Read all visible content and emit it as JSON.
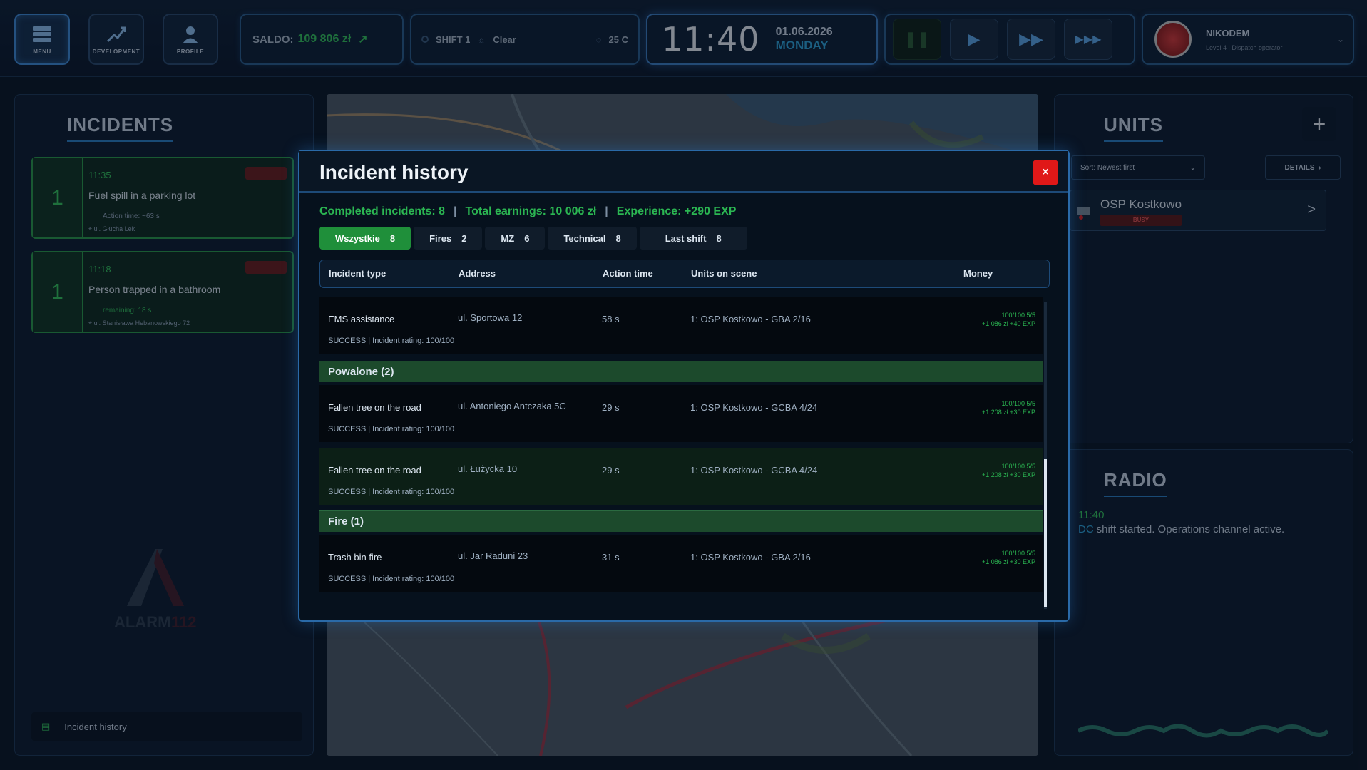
{
  "topbar": {
    "nav": [
      {
        "label": "MENU",
        "icon": "menu-icon"
      },
      {
        "label": "DEVELOPMENT",
        "icon": "development-icon"
      },
      {
        "label": "PROFILE",
        "icon": "profile-icon"
      }
    ],
    "saldo_label": "SALDO:",
    "saldo_value": "109 806 zł",
    "shift_label": "SHIFT 1",
    "weather": "Clear",
    "temperature": "25 C",
    "time": "11:40",
    "date": "01.06.2026",
    "day": "MONDAY",
    "speed_buttons": [
      "pause",
      "play",
      "fast-forward",
      "fastest-forward"
    ],
    "user_name": "NIKODEM",
    "user_level": "Level 4 | Dispatch operator"
  },
  "incidents": {
    "title": "INCIDENTS",
    "items": [
      {
        "count": "1",
        "time": "11:35",
        "title": "Fuel spill in a parking lot",
        "sub": "Action time: ~63 s",
        "address": "ul. Głucha Lek"
      },
      {
        "count": "1",
        "time": "11:18",
        "title": "Person trapped in a bathroom",
        "sub": "remaining: 18 s",
        "address": "ul. Stanisława Hebanowskiego 72"
      }
    ],
    "logo_text": "ALARM 112",
    "history_link": "Incident history"
  },
  "units": {
    "title": "UNITS",
    "add_label": "+",
    "sort": "Sort: Newest first",
    "details": "DETAILS",
    "items": [
      {
        "name": "OSP Kostkowo",
        "badge": "BUSY"
      }
    ]
  },
  "radio": {
    "title": "RADIO",
    "time": "11:40",
    "who": "DC",
    "message": "shift started. Operations channel active."
  },
  "modal": {
    "title": "Incident history",
    "close": "×",
    "stats": {
      "completed": "Completed incidents: 8",
      "earnings": "Total earnings: 10 006 zł",
      "experience": "Experience: +290 EXP"
    },
    "tabs": [
      {
        "label": "Wszystkie",
        "count": "8"
      },
      {
        "label": "Fires",
        "count": "2"
      },
      {
        "label": "MZ",
        "count": "6"
      },
      {
        "label": "Technical",
        "count": "8"
      },
      {
        "label": "Last shift",
        "count": "8"
      }
    ],
    "columns": [
      "Incident type",
      "Address",
      "Action time",
      "Units on scene",
      "Money"
    ],
    "rows": [
      {
        "type": "EMS assistance",
        "address": "ul. Sportowa 12",
        "time": "58 s",
        "units": "1: OSP Kostkowo - GBA 2/16",
        "status": "SUCCESS | Incident rating: 100/100",
        "money_1": "100/100 5/5",
        "money_2": "+1 086 zł +40 EXP"
      },
      {
        "group": "Powalone (2)"
      },
      {
        "type": "Fallen tree on the road",
        "address": "ul. Antoniego Antczaka 5C",
        "time": "29 s",
        "units": "1: OSP Kostkowo - GCBA 4/24",
        "status": "SUCCESS | Incident rating: 100/100",
        "money_1": "100/100 5/5",
        "money_2": "+1 208 zł +30 EXP"
      },
      {
        "type": "Fallen tree on the road",
        "address": "ul. Łużycka 10",
        "time": "29 s",
        "units": "1: OSP Kostkowo - GCBA 4/24",
        "status": "SUCCESS | Incident rating: 100/100",
        "money_1": "100/100 5/5",
        "money_2": "+1 208 zł +30 EXP"
      },
      {
        "group": "Fire (1)"
      },
      {
        "type": "Trash bin fire",
        "address": "ul. Jar Raduni 23",
        "time": "31 s",
        "units": "1: OSP Kostkowo - GBA 2/16",
        "status": "SUCCESS | Incident rating: 100/100",
        "money_1": "100/100 5/5",
        "money_2": "+1 086 zł +30 EXP"
      }
    ]
  },
  "colors": {
    "accent_blue": "#2a7ec4",
    "success_green": "#2bb652",
    "danger_red": "#e01818"
  }
}
